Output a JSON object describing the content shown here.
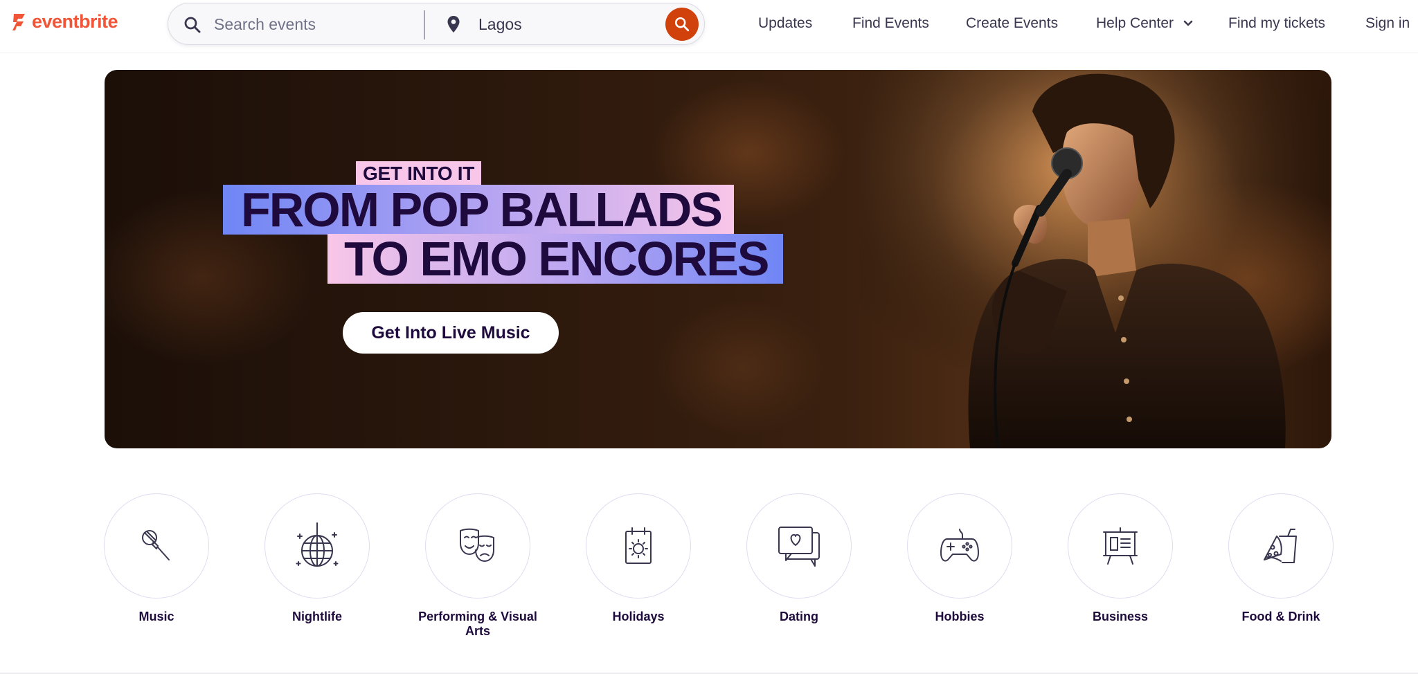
{
  "brand": {
    "name": "eventbrite",
    "color": "#f05537"
  },
  "search": {
    "placeholder": "Search events",
    "location_value": "Lagos",
    "search_icon": "search-icon",
    "location_icon": "map-pin-icon",
    "submit_icon": "search-icon",
    "submit_color": "#d1410c"
  },
  "nav": {
    "updates": "Updates",
    "find_events": "Find Events",
    "create_events": "Create Events",
    "help_center": "Help Center",
    "find_tickets": "Find my tickets",
    "sign_in": "Sign in"
  },
  "hero": {
    "kicker": "GET INTO IT",
    "line1": "FROM POP BALLADS",
    "line2": "TO EMO ENCORES",
    "cta": "Get Into Live Music"
  },
  "categories": [
    {
      "label": "Music",
      "icon": "microphone-icon"
    },
    {
      "label": "Nightlife",
      "icon": "disco-ball-icon"
    },
    {
      "label": "Performing & Visual Arts",
      "icon": "theater-masks-icon"
    },
    {
      "label": "Holidays",
      "icon": "calendar-icon"
    },
    {
      "label": "Dating",
      "icon": "chat-heart-icon"
    },
    {
      "label": "Hobbies",
      "icon": "game-controller-icon"
    },
    {
      "label": "Business",
      "icon": "presentation-board-icon"
    },
    {
      "label": "Food & Drink",
      "icon": "pizza-drink-icon"
    }
  ]
}
